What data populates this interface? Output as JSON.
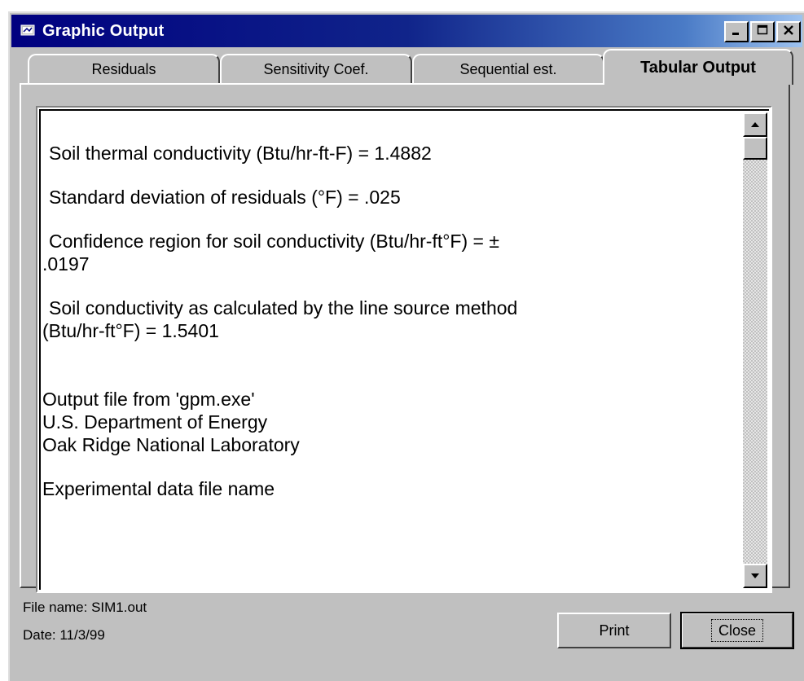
{
  "window": {
    "title": "Graphic Output",
    "app_icon": "window-app-icon",
    "buttons": {
      "minimize": "minimize-icon",
      "maximize": "maximize-icon",
      "close": "close-icon"
    }
  },
  "tabs": [
    {
      "label": "Residuals",
      "active": false
    },
    {
      "label": "Sensitivity Coef.",
      "active": false
    },
    {
      "label": "Sequential est.",
      "active": false
    },
    {
      "label": "Tabular Output",
      "active": true
    }
  ],
  "output": {
    "lines": [
      " Soil thermal conductivity (Btu/hr-ft-F) =   1.4882",
      " Standard deviation of residuals (°F) =  .025",
      " Confidence region for soil conductivity (Btu/hr-ft°F) = ±",
      ".0197",
      " Soil conductivity as calculated by the line source method",
      "(Btu/hr-ft°F) =  1.5401",
      "Output file from 'gpm.exe'",
      "U.S. Department of Energy",
      "Oak Ridge National Laboratory",
      "Experimental data file name"
    ]
  },
  "scrollbar": {
    "up": "scroll-up-arrow-icon",
    "down": "scroll-down-arrow-icon"
  },
  "status": {
    "file_name": "File name: SIM1.out",
    "date": "Date: 11/3/99"
  },
  "footer": {
    "print_label": "Print",
    "close_label": "Close"
  },
  "colors": {
    "titlebar_start": "#000080",
    "titlebar_end": "#9ec3f0",
    "face": "#c0c0c0"
  }
}
